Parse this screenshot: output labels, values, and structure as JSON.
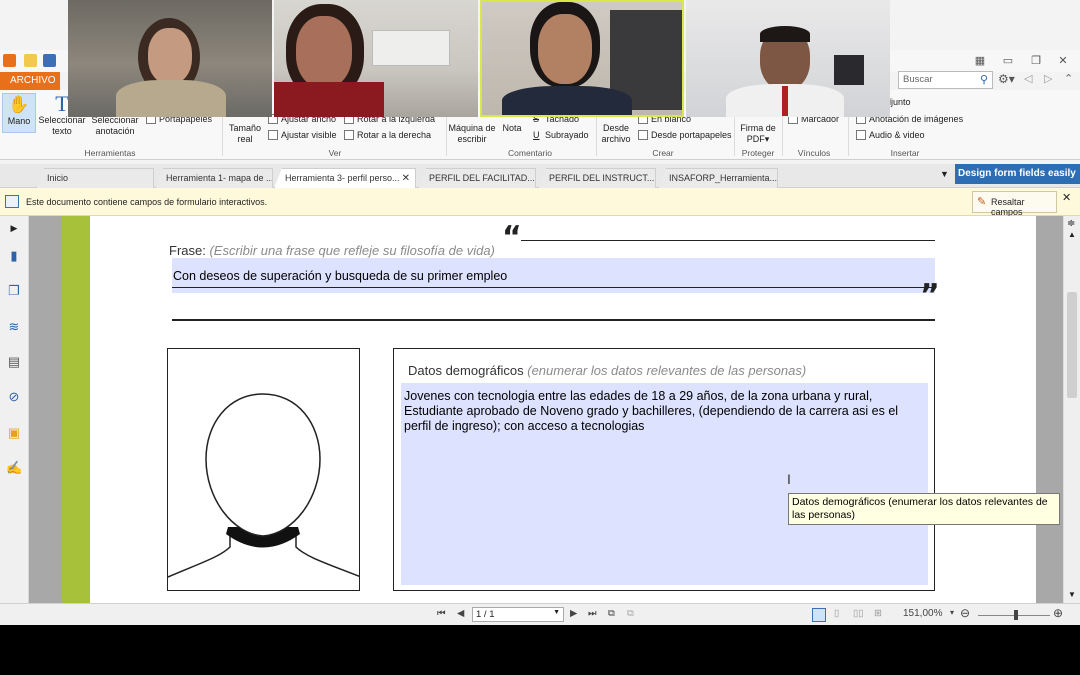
{
  "toolbar": {
    "file_tab": "ARCHIVO",
    "search_placeholder": "Buscar",
    "herramientas": {
      "mano": "Mano",
      "seleccionar_texto": "Seleccionar texto",
      "seleccionar_anotacion": "Seleccionar anotación",
      "portapapeles": "Portapapeles",
      "group": "Herramientas"
    },
    "ver": {
      "tamano_real": "Tamaño real",
      "ajustar_ancho": "Ajustar ancho",
      "ajustar_visible": "Ajustar visible",
      "rotar_izq": "Rotar a la izquierda",
      "rotar_der": "Rotar a la derecha",
      "group": "Ver"
    },
    "comentario": {
      "maquina": "Máquina de escribir",
      "nota": "Nota",
      "tachado": "Tachado",
      "subrayado": "Subrayado",
      "group": "Comentario"
    },
    "crear": {
      "desde_archivo": "Desde archivo",
      "en_blanco": "En blanco",
      "desde_portapapeles": "Desde portapapeles",
      "group": "Crear"
    },
    "proteger": {
      "firma": "Firma de PDF▾",
      "group": "Proteger"
    },
    "vinculos": {
      "marcador": "Marcador",
      "group": "Vínculos"
    },
    "insertar": {
      "adjunto": "vo adjunto",
      "anotacion_imagenes": "Anotación de imágenes",
      "audio_video": "Audio & video",
      "group": "Insertar"
    }
  },
  "tabs": [
    {
      "label": "Inicio"
    },
    {
      "label": "Herramienta 1- mapa de ..."
    },
    {
      "label": "Herramienta 3- perfil perso..."
    },
    {
      "label": "PERFIL DEL FACILITAD..."
    },
    {
      "label": "PERFIL DEL INSTRUCT..."
    },
    {
      "label": "INSAFORP_Herramienta..."
    }
  ],
  "design_button": "Design form fields easily",
  "infobar": {
    "message": "Este documento contiene campos de formulario interactivos.",
    "highlight_button": "Resaltar campos"
  },
  "document": {
    "frase_label": "Frase:",
    "frase_hint": "(Escribir una frase que refleje su filosofía de vida)",
    "frase_value": "Con deseos de superación y busqueda de su primer empleo",
    "quote_open": "“",
    "quote_close": "”",
    "demo_label": "Datos demográficos",
    "demo_hint": "(enumerar los datos relevantes de las personas)",
    "demo_value": "Jovenes con tecnologia entre las edades de 18 a 29 años, de la zona urbana y rural, Estudiante  aprobado de Noveno grado y bachilleres, (dependiendo de la carrera asi es el perfil de ingreso); con acceso a tecnologias",
    "tooltip": "Datos demográficos (enumerar los datos relevantes de las personas)"
  },
  "statusbar": {
    "page": "1 / 1",
    "zoom": "151,00%"
  },
  "icons": [
    "hand-icon",
    "text-select-icon",
    "bookmark-icon",
    "pages-icon",
    "layers-icon",
    "comments-icon",
    "attachment-icon",
    "lock-icon",
    "signature-icon"
  ]
}
